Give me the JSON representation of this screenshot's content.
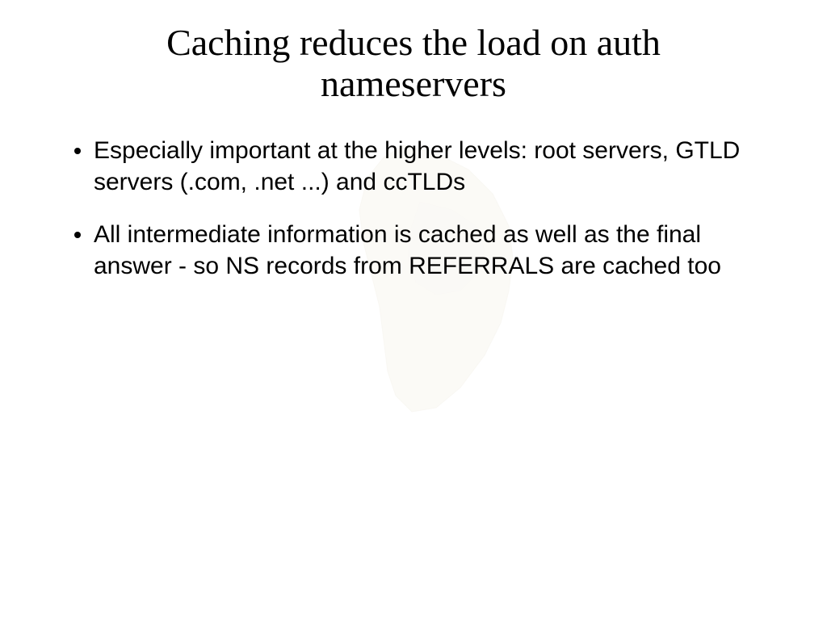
{
  "slide": {
    "title": "Caching reduces the load on auth nameservers",
    "bullets": [
      "Especially important at the higher levels: root servers, GTLD servers (.com, .net ...) and ccTLDs",
      "All intermediate information is cached as well as the final answer - so NS records from REFERRALS are cached too"
    ]
  }
}
